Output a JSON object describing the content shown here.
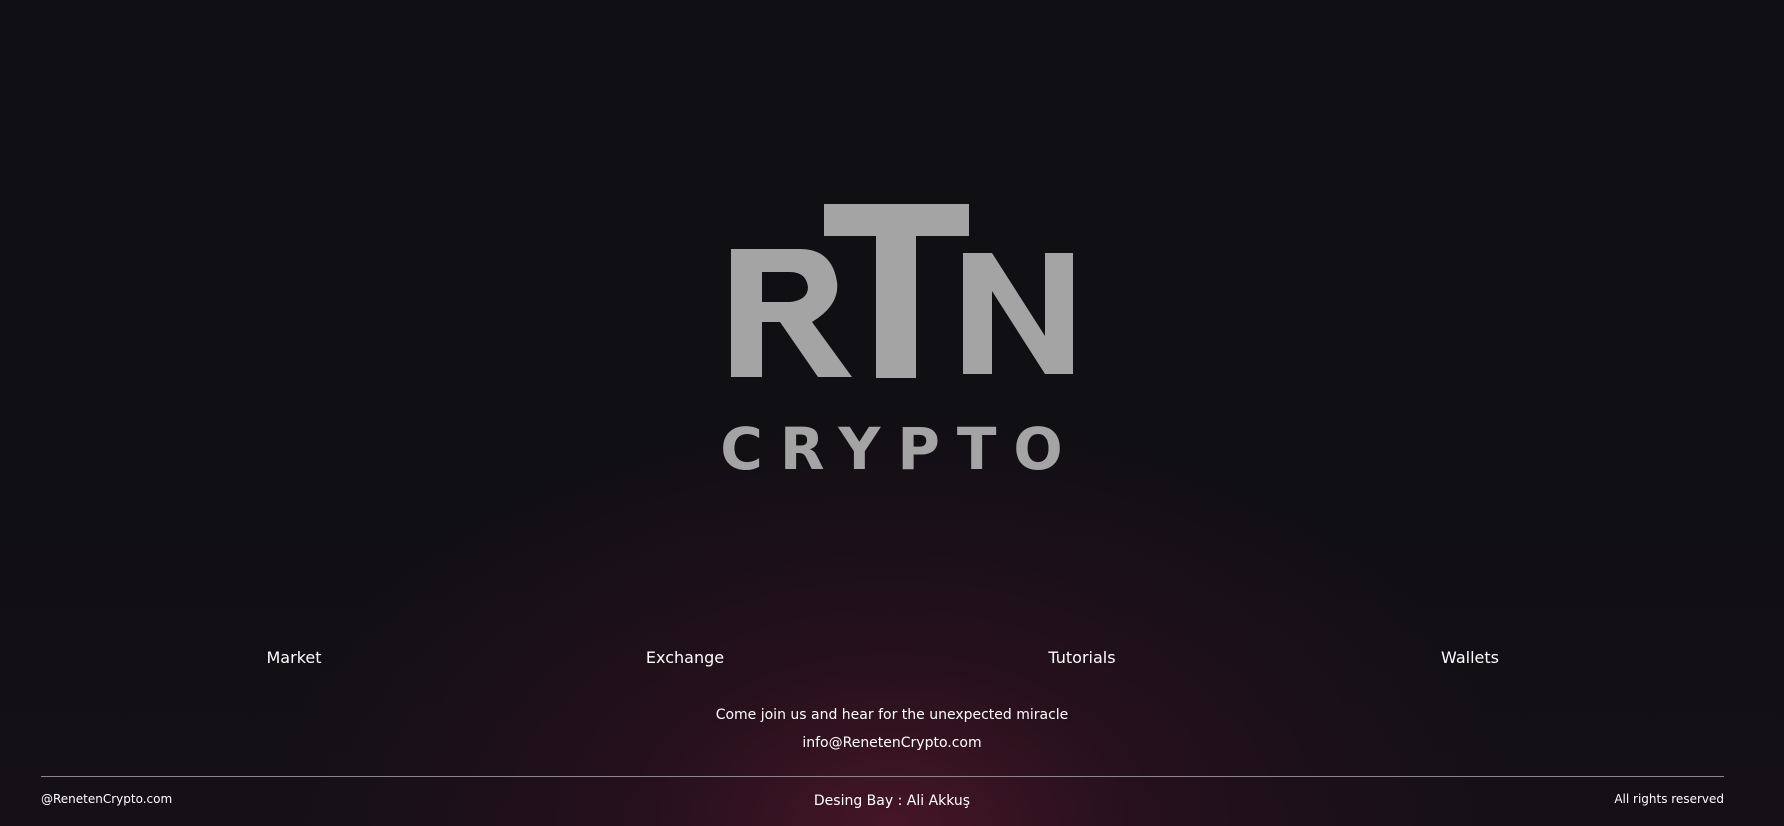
{
  "logo": {
    "letters": "RTN",
    "wordmark": "CRYPTO",
    "color": "#a4a4a4"
  },
  "nav": {
    "items": [
      {
        "label": "Market"
      },
      {
        "label": "Exchange"
      },
      {
        "label": "Tutorials"
      },
      {
        "label": "Wallets"
      }
    ]
  },
  "contact": {
    "tagline": "Come join us and hear for the unexpected miracle",
    "email": "info@RenetenCrypto.com"
  },
  "footer": {
    "handle": "@RenetenCrypto.com",
    "credit": "Desing Bay : Ali Akkuş",
    "rights": "All rights reserved"
  },
  "colors": {
    "background": "#0f0e13",
    "glow": "#48162a",
    "text": "#ffffff",
    "divider": "#8a878d"
  }
}
